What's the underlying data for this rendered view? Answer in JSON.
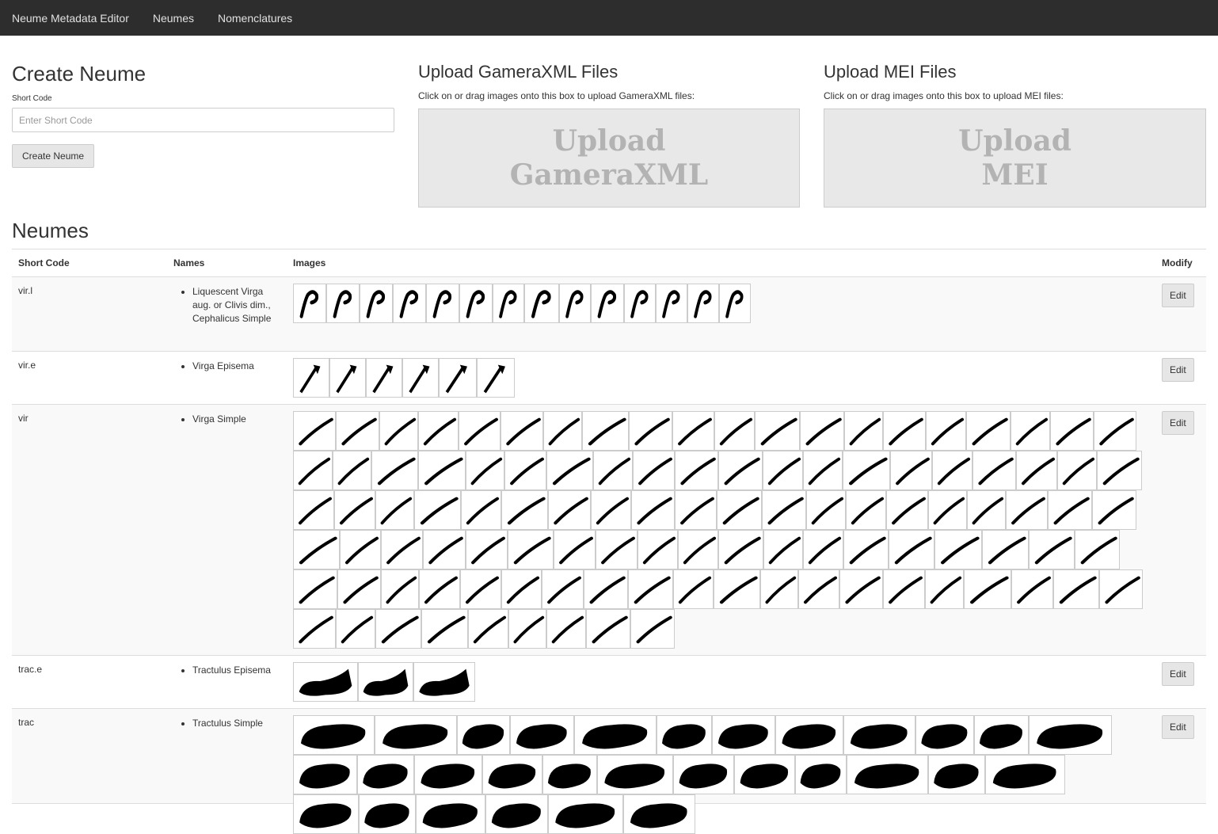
{
  "nav": {
    "brand": "Neume Metadata Editor",
    "links": [
      "Neumes",
      "Nomenclatures"
    ]
  },
  "create": {
    "title": "Create Neume",
    "label": "Short Code",
    "placeholder": "Enter Short Code",
    "button": "Create Neume"
  },
  "gamera": {
    "title": "Upload GameraXML Files",
    "hint": "Click on or drag images onto this box to upload GameraXML files:",
    "dropzone": "Upload\nGameraXML"
  },
  "mei": {
    "title": "Upload MEI Files",
    "hint": "Click on or drag images onto this box to upload MEI files:",
    "dropzone": "Upload\nMEI"
  },
  "neumes": {
    "title": "Neumes",
    "headers": {
      "code": "Short Code",
      "names": "Names",
      "images": "Images",
      "modify": "Modify"
    },
    "edit_label": "Edit",
    "rows": [
      {
        "code": "vir.l",
        "names": [
          "Liquescent Virga aug. or Clivis dim., Cephalicus Simple"
        ],
        "shape": "hook",
        "image_count": 14
      },
      {
        "code": "vir.e",
        "names": [
          "Virga Episema"
        ],
        "shape": "episema",
        "image_count": 6
      },
      {
        "code": "vir",
        "names": [
          "Virga Simple"
        ],
        "shape": "stroke",
        "image_count": 108
      },
      {
        "code": "trac.e",
        "names": [
          "Tractulus Episema"
        ],
        "shape": "blob-tail",
        "image_count": 3
      },
      {
        "code": "trac",
        "names": [
          "Tractulus Simple"
        ],
        "shape": "blob",
        "image_count": 30
      }
    ]
  }
}
